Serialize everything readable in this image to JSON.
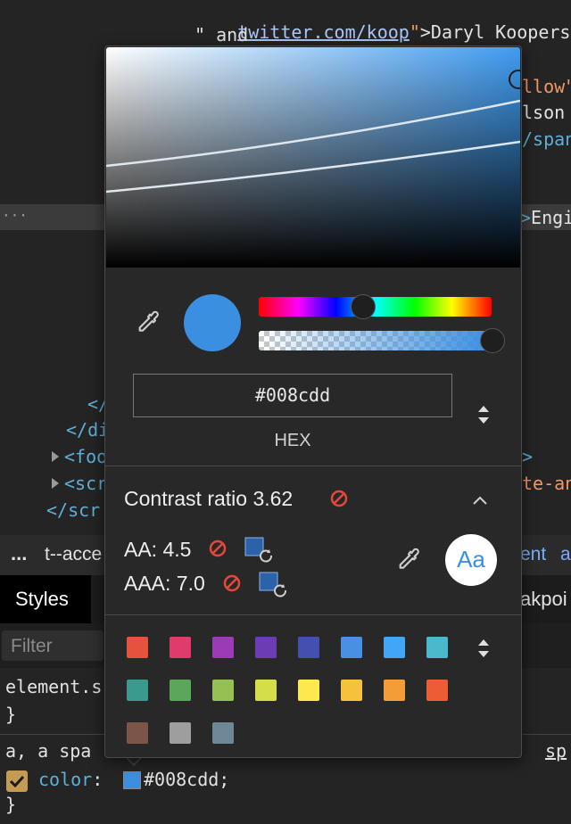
{
  "code": {
    "line1_url": "twitter.com/koop",
    "line1_attr_end": "\"",
    "line1_text": ">Daryl Koopersm",
    "line2": "\" and",
    "line3_attr": "llow\"",
    "line4": "lson",
    "line5_tag": "/span",
    "line6_dots": "…",
    "line6_tag": ">Engi",
    "line7": "</",
    "line8": "</di",
    "line9_tag": "<foo",
    "line9_end": ">",
    "line10_tag": "<scr",
    "line10_end": "te-an",
    "line11": "</scr"
  },
  "styles": {
    "tabbar_more": "...",
    "tabbar_text_left": "t--acce",
    "tabbar_text_right1": "ent",
    "tabbar_text_right2": "a",
    "tab_styles": "Styles",
    "tab_right": "akpoi",
    "filter_placeholder": "Filter",
    "rule1_selector": "element.s",
    "rule1_close": "}",
    "rule2_selector": "a, a spa",
    "rule2_selector_right": "sp",
    "prop_name": "color",
    "prop_value": "#008cdd;",
    "rule2_close": "}"
  },
  "picker": {
    "current_color": "#3b8fe0",
    "hex_value": "#008cdd",
    "format_label": "HEX",
    "contrast_label": "Contrast ratio",
    "contrast_value": "3.62",
    "aa_label": "AA: 4.5",
    "aaa_label": "AAA: 7.0",
    "preview_text": "Aa",
    "palette": [
      "#e5533f",
      "#de3c6b",
      "#9c3bb5",
      "#6b3db5",
      "#4450ae",
      "#4a90e2",
      "#42a5f5",
      "#4bb8cc",
      "#3b9a8e",
      "#5ba65a",
      "#95c154",
      "#d4de4a",
      "#fce94f",
      "#f6c23e",
      "#f29d38",
      "#ec5d35",
      "#7b5548",
      "#9e9e9e",
      "#6f8898"
    ]
  }
}
